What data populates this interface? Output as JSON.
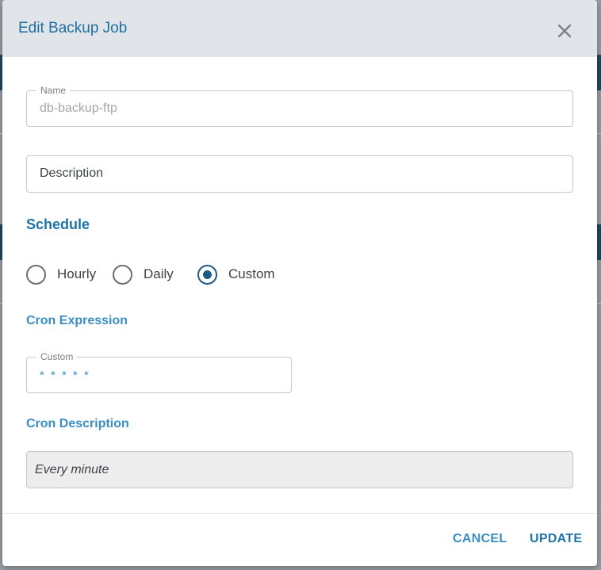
{
  "dialog": {
    "title": "Edit Backup Job"
  },
  "form": {
    "name": {
      "label": "Name",
      "value": "db-backup-ftp"
    },
    "description": {
      "placeholder": "Description"
    }
  },
  "schedule": {
    "heading": "Schedule",
    "options": [
      {
        "label": "Hourly",
        "selected": false
      },
      {
        "label": "Daily",
        "selected": false
      },
      {
        "label": "Custom",
        "selected": true
      }
    ]
  },
  "cron": {
    "heading": "Cron Expression",
    "field_label": "Custom",
    "value": "* * * * *"
  },
  "cron_description": {
    "heading": "Cron Description",
    "value": "Every minute"
  },
  "actions": {
    "cancel_label": "CANCEL",
    "update_label": "UPDATE"
  },
  "colors": {
    "accent": "#1e74a8",
    "header_bg": "#e1e5e9",
    "radio_selected": "#1f5a86"
  },
  "icons": {
    "close": "close-icon"
  }
}
